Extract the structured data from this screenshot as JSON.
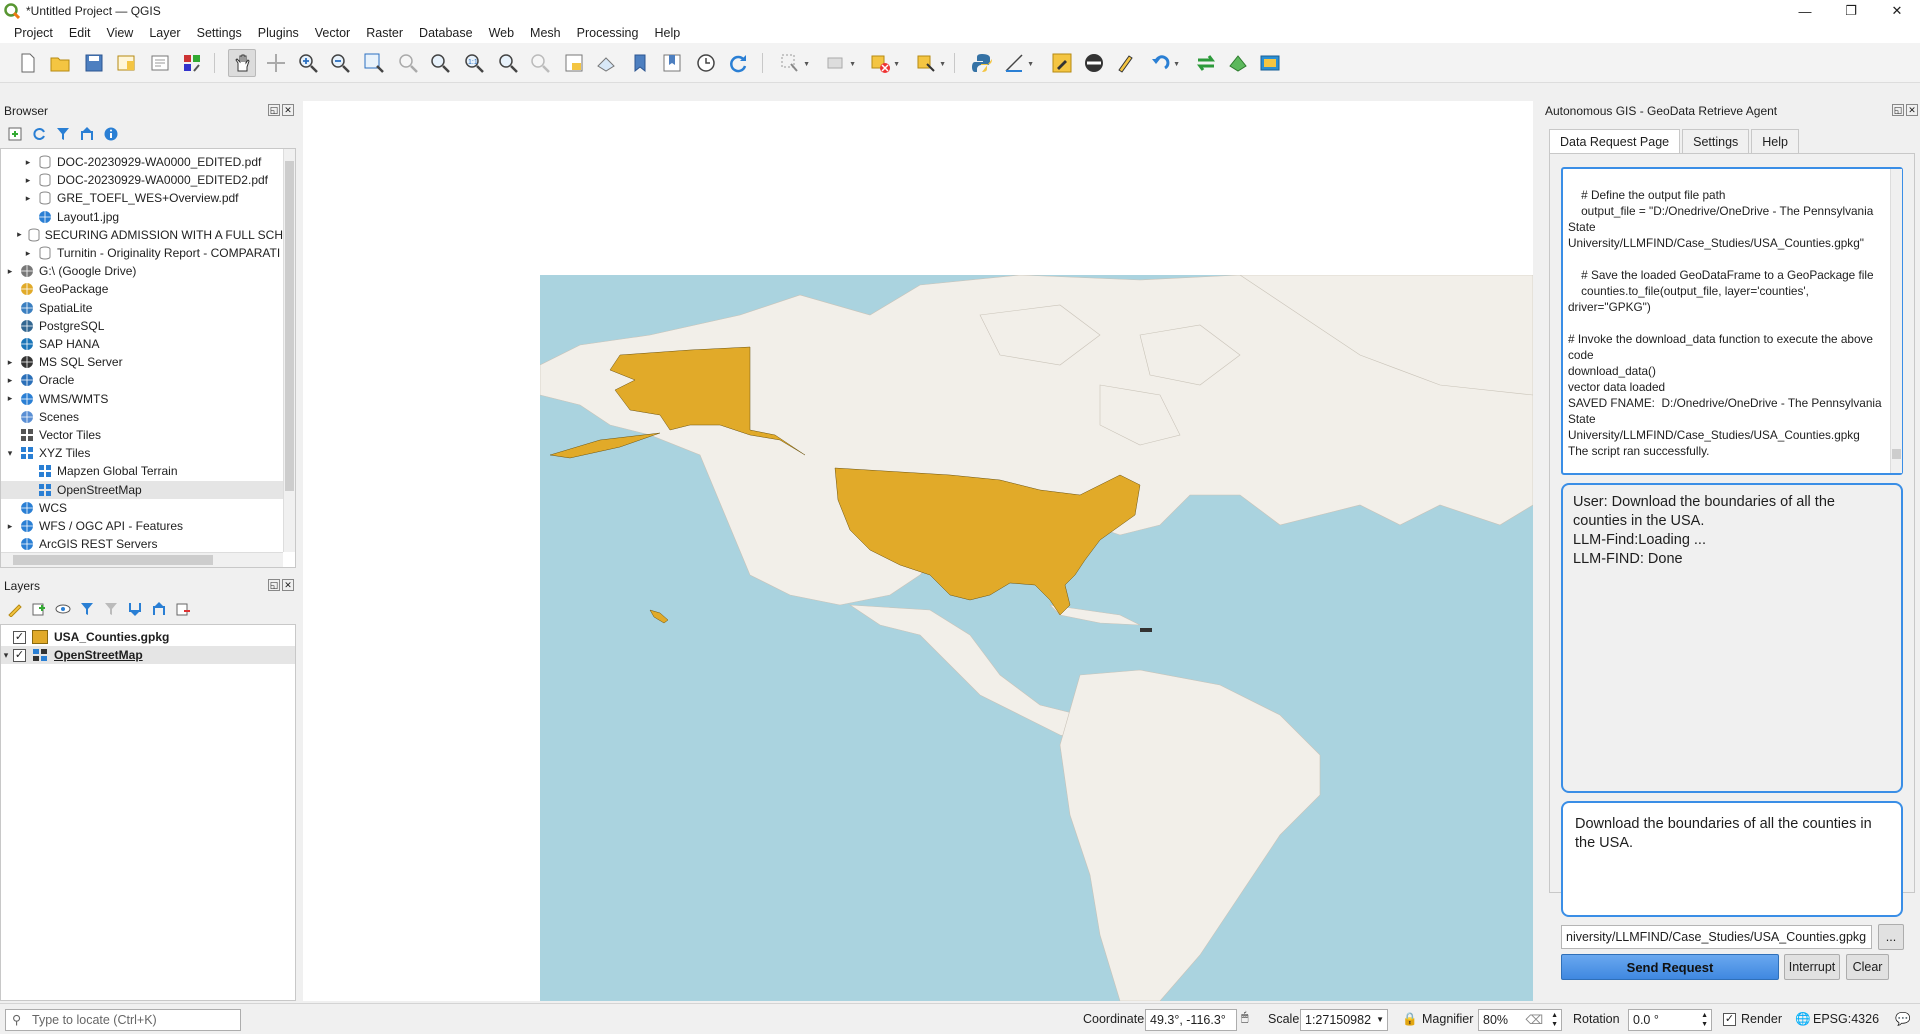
{
  "window": {
    "title": "*Untitled Project — QGIS",
    "controls": [
      "—",
      "❐",
      "✕"
    ]
  },
  "menu": [
    "Project",
    "Edit",
    "View",
    "Layer",
    "Settings",
    "Plugins",
    "Vector",
    "Raster",
    "Database",
    "Web",
    "Mesh",
    "Processing",
    "Help"
  ],
  "browser": {
    "title": "Browser",
    "items": [
      {
        "label": "DOC-20230929-WA0000_EDITED.pdf",
        "indent": 2,
        "icon": "file-icon",
        "arrow": true
      },
      {
        "label": "DOC-20230929-WA0000_EDITED2.pdf",
        "indent": 2,
        "icon": "file-icon",
        "arrow": true
      },
      {
        "label": "GRE_TOEFL_WES+Overview.pdf",
        "indent": 2,
        "icon": "file-icon",
        "arrow": true
      },
      {
        "label": "Layout1.jpg",
        "indent": 2,
        "icon": "raster-icon",
        "arrow": false
      },
      {
        "label": "SECURING ADMISSION WITH A FULL SCH",
        "indent": 2,
        "icon": "file-icon",
        "arrow": true
      },
      {
        "label": "Turnitin - Originality Report - COMPARATI",
        "indent": 2,
        "icon": "file-icon",
        "arrow": true
      },
      {
        "label": "G:\\ (Google Drive)",
        "indent": 0,
        "icon": "drive-icon",
        "arrow": true
      },
      {
        "label": "GeoPackage",
        "indent": 1,
        "icon": "geopackage-icon",
        "arrow": false
      },
      {
        "label": "SpatiaLite",
        "indent": 1,
        "icon": "spatialite-icon",
        "arrow": false
      },
      {
        "label": "PostgreSQL",
        "indent": 1,
        "icon": "postgresql-icon",
        "arrow": false
      },
      {
        "label": "SAP HANA",
        "indent": 1,
        "icon": "saphana-icon",
        "arrow": false
      },
      {
        "label": "MS SQL Server",
        "indent": 0,
        "icon": "mssql-icon",
        "arrow": true
      },
      {
        "label": "Oracle",
        "indent": 0,
        "icon": "oracle-icon",
        "arrow": true
      },
      {
        "label": "WMS/WMTS",
        "indent": 0,
        "icon": "wms-icon",
        "arrow": true
      },
      {
        "label": "Scenes",
        "indent": 1,
        "icon": "scenes-icon",
        "arrow": false
      },
      {
        "label": "Vector Tiles",
        "indent": 1,
        "icon": "vector-tiles-icon",
        "arrow": false
      },
      {
        "label": "XYZ Tiles",
        "indent": 0,
        "icon": "xyz-tiles-icon",
        "arrow": true,
        "expanded": true
      },
      {
        "label": "Mapzen Global Terrain",
        "indent": 2,
        "icon": "tiles-icon",
        "arrow": false
      },
      {
        "label": "OpenStreetMap",
        "indent": 2,
        "icon": "tiles-icon",
        "arrow": false,
        "selected": true
      },
      {
        "label": "WCS",
        "indent": 1,
        "icon": "wcs-icon",
        "arrow": false
      },
      {
        "label": "WFS / OGC API - Features",
        "indent": 0,
        "icon": "wfs-icon",
        "arrow": true
      },
      {
        "label": "ArcGIS REST Servers",
        "indent": 1,
        "icon": "arcgis-icon",
        "arrow": false
      }
    ]
  },
  "layers": {
    "title": "Layers",
    "items": [
      {
        "label": "USA_Counties.gpkg",
        "checked": true,
        "color": "#e1aa29",
        "arrow": false
      },
      {
        "label": "OpenStreetMap",
        "checked": true,
        "color": "",
        "arrow": true
      }
    ]
  },
  "agent": {
    "title": "Autonomous GIS - GeoData Retrieve Agent",
    "tabs": [
      "Data Request Page",
      "Settings",
      "Help"
    ],
    "code_output": "    # Define the output file path\n    output_file = \"D:/Onedrive/OneDrive - The Pennsylvania State University/LLMFIND/Case_Studies/USA_Counties.gpkg\"\n\n    # Save the loaded GeoDataFrame to a GeoPackage file\n    counties.to_file(output_file, layer='counties', driver=\"GPKG\")\n\n# Invoke the download_data function to execute the above code\ndownload_data()\nvector data loaded\nSAVED FNAME:  D:/Onedrive/OneDrive - The Pennsylvania State University/LLMFIND/Case_Studies/USA_Counties.gpkg\nThe script ran successfully.",
    "chat_lines": [
      "User: Download the boundaries of all the counties in the USA.",
      "LLM-Find:Loading ...",
      "LLM-FIND: Done"
    ],
    "request_text": "Download the boundaries of all the counties in the USA.",
    "output_path": "niversity/LLMFIND/Case_Studies/USA_Counties.gpkg",
    "browse_label": "...",
    "send_label": "Send Request",
    "interrupt_label": "Interrupt",
    "clear_label": "Clear"
  },
  "status": {
    "locate_placeholder": "Type to locate (Ctrl+K)",
    "coordinate_label": "Coordinate",
    "coordinate_value": "49.3°, -116.3°",
    "scale_label": "Scale",
    "scale_value": "1:27150982",
    "magnifier_label": "Magnifier",
    "magnifier_value": "80%",
    "rotation_label": "Rotation",
    "rotation_value": "0.0 °",
    "render_label": "Render",
    "crs": "EPSG:4326"
  },
  "colors": {
    "accent": "#3a8ee6",
    "counties_fill": "#e1aa29",
    "ocean": "#aad3df",
    "land": "#f2efe9"
  }
}
